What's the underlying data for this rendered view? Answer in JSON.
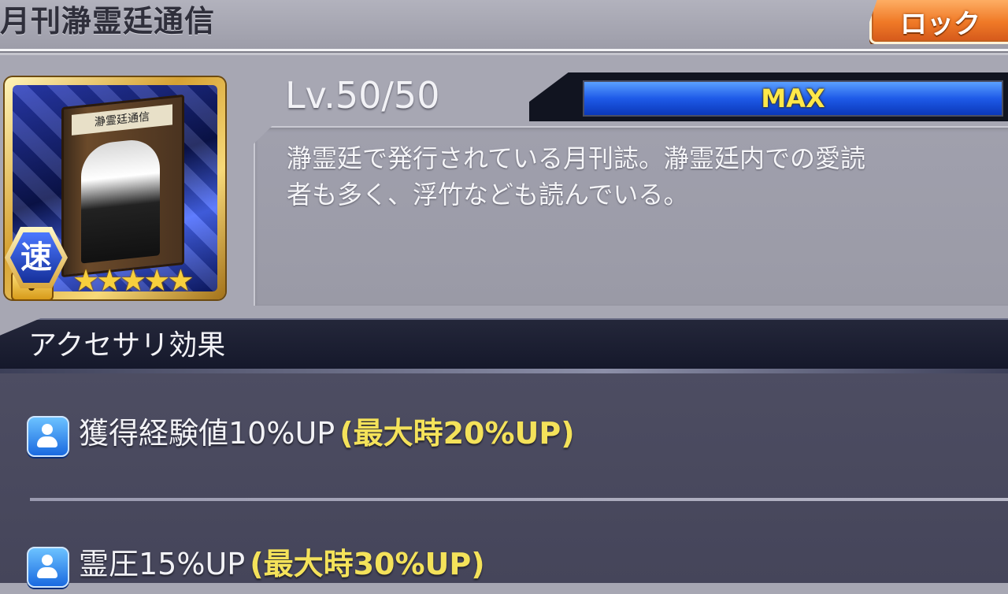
{
  "header": {
    "title": "月刊瀞霊廷通信",
    "lock_button_label": "ロック"
  },
  "accessory": {
    "icon_name": "book-accessory-icon",
    "book_cover_text": "瀞霊廷通信",
    "locked": true,
    "type_badge": "速",
    "stars": 5,
    "star_glyph": "★"
  },
  "level": {
    "label": "Lv.50/50",
    "current": 50,
    "max": 50,
    "bar_label": "MAX",
    "progress_fraction": 1.0
  },
  "description": {
    "line1": "瀞霊廷で発行されている月刊誌。瀞霊廷内での愛読",
    "line2": "者も多く、浮竹なども読んでいる。"
  },
  "effects_section": {
    "title": "アクセサリ効果",
    "items": [
      {
        "icon": "person-effect-icon",
        "text": "獲得経験値10%UP",
        "max_text": "(最大時20%UP)"
      },
      {
        "icon": "person-effect-icon",
        "text": "霊圧15%UP",
        "max_text": "(最大時30%UP)"
      }
    ]
  },
  "colors": {
    "accent_orange": "#f07a27",
    "max_text": "#ffe84a",
    "effect_max_text": "#f4e25a",
    "level_bar": "#1e5ae8"
  }
}
